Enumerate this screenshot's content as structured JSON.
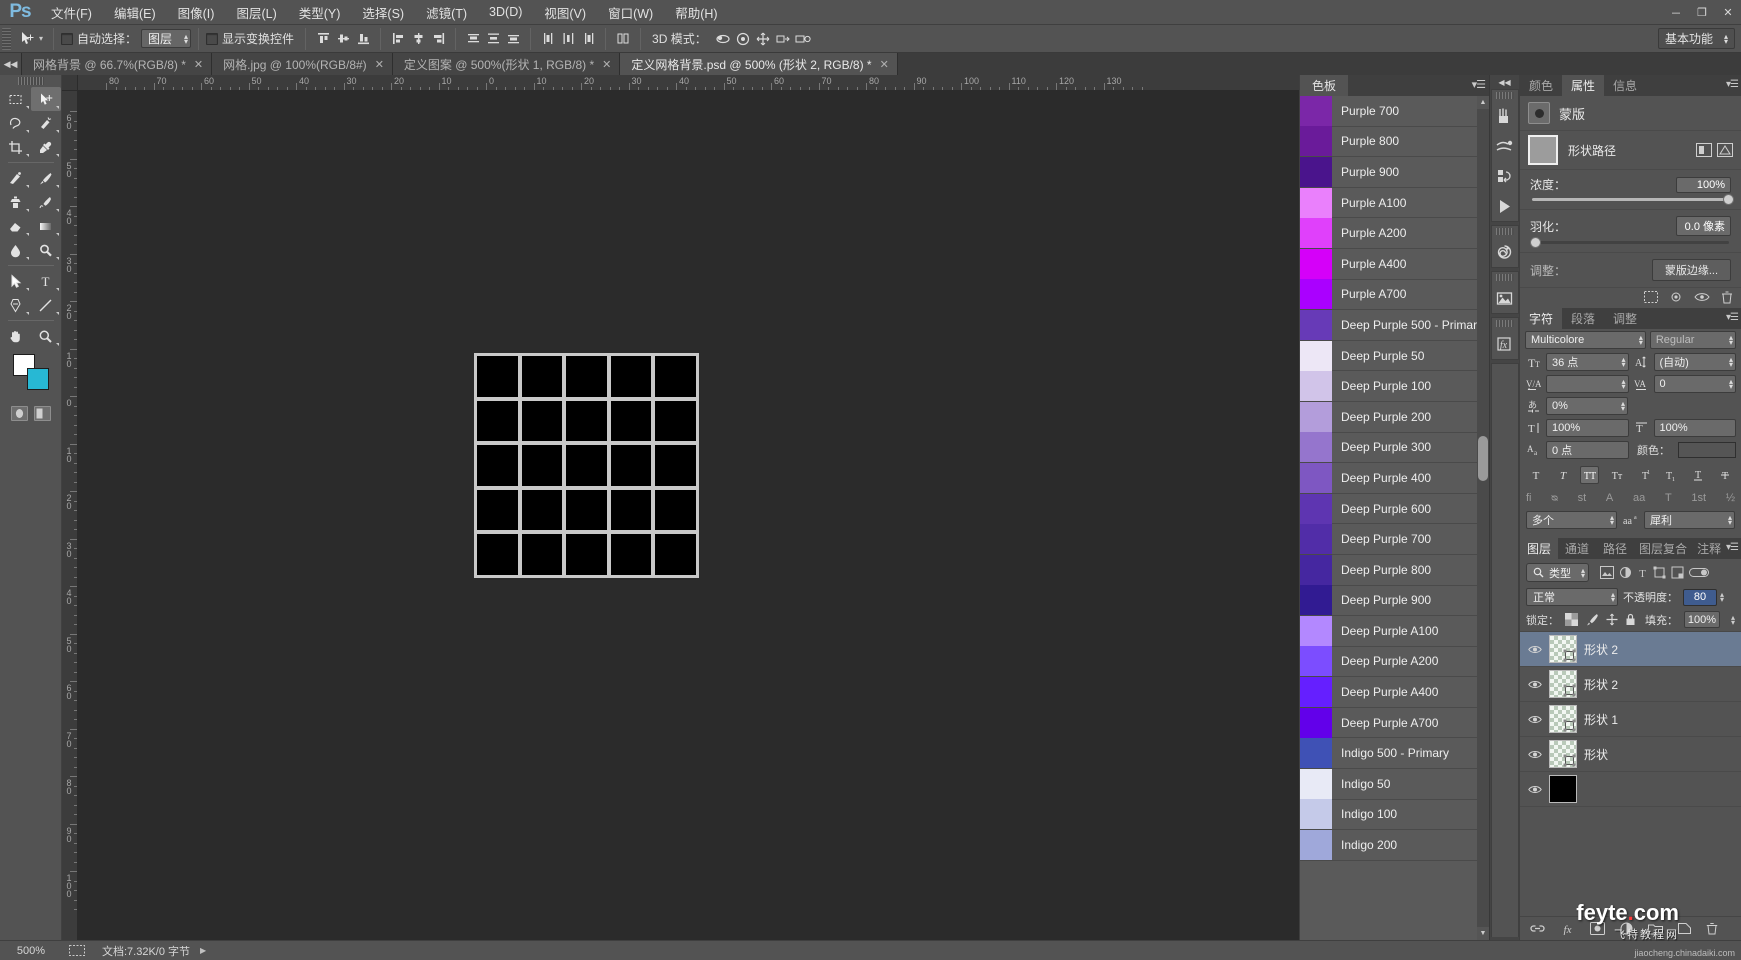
{
  "app": {
    "logo": "Ps",
    "menus": [
      "文件(F)",
      "编辑(E)",
      "图像(I)",
      "图层(L)",
      "类型(Y)",
      "选择(S)",
      "滤镜(T)",
      "3D(D)",
      "视图(V)",
      "窗口(W)",
      "帮助(H)"
    ],
    "window_buttons": [
      "－",
      "❐",
      "✕"
    ]
  },
  "options_bar": {
    "auto_select_label": "自动选择：",
    "auto_select_value": "图层",
    "show_transform_label": "显示变换控件",
    "mode3d_label": "3D 模式：",
    "workspace_label": "基本功能"
  },
  "tabs": [
    {
      "title": "网格背景 @ 66.7%(RGB/8) *",
      "active": false
    },
    {
      "title": "网格.jpg @ 100%(RGB/8#)",
      "active": false
    },
    {
      "title": "定义图案 @ 500%(形状 1, RGB/8) *",
      "active": false
    },
    {
      "title": "定义网格背景.psd @ 500% (形状 2, RGB/8) *",
      "active": true
    }
  ],
  "ruler": {
    "h_labels": [
      "80",
      "70",
      "60",
      "50",
      "40",
      "30",
      "20",
      "10",
      "0",
      "10",
      "20",
      "30",
      "40",
      "50",
      "60",
      "70",
      "80",
      "90",
      "100",
      "110",
      "120",
      "130"
    ],
    "v_labels": [
      "60",
      "50",
      "40",
      "30",
      "20",
      "10",
      "0",
      "10",
      "20",
      "30",
      "40",
      "50",
      "60",
      "70",
      "80",
      "90",
      "100"
    ]
  },
  "swatches_panel": {
    "tab_label": "色板",
    "items": [
      {
        "name": "Purple 700",
        "color": "#7b27a8"
      },
      {
        "name": "Purple 800",
        "color": "#6a1b9a"
      },
      {
        "name": "Purple 900",
        "color": "#4a148c"
      },
      {
        "name": "Purple A100",
        "color": "#ea80fc"
      },
      {
        "name": "Purple A200",
        "color": "#e040fb"
      },
      {
        "name": "Purple A400",
        "color": "#d500f9"
      },
      {
        "name": "Purple A700",
        "color": "#aa00ff"
      },
      {
        "name": "Deep Purple 500 - Primary",
        "color": "#673ab7"
      },
      {
        "name": "Deep Purple 50",
        "color": "#ede7f6"
      },
      {
        "name": "Deep Purple 100",
        "color": "#d1c4e9"
      },
      {
        "name": "Deep Purple 200",
        "color": "#b39ddb"
      },
      {
        "name": "Deep Purple 300",
        "color": "#9575cd"
      },
      {
        "name": "Deep Purple 400",
        "color": "#7e57c2"
      },
      {
        "name": "Deep Purple 600",
        "color": "#5e35b1"
      },
      {
        "name": "Deep Purple 700",
        "color": "#512da8"
      },
      {
        "name": "Deep Purple 800",
        "color": "#4527a0"
      },
      {
        "name": "Deep Purple 900",
        "color": "#311b92"
      },
      {
        "name": "Deep Purple A100",
        "color": "#b388ff"
      },
      {
        "name": "Deep Purple A200",
        "color": "#7c4dff"
      },
      {
        "name": "Deep Purple A400",
        "color": "#651fff"
      },
      {
        "name": "Deep Purple A700",
        "color": "#6200ea"
      },
      {
        "name": "Indigo 500 - Primary",
        "color": "#3f51b5"
      },
      {
        "name": "Indigo 50",
        "color": "#e8eaf6"
      },
      {
        "name": "Indigo 100",
        "color": "#c5cae9"
      },
      {
        "name": "Indigo 200",
        "color": "#9fa8da"
      }
    ]
  },
  "properties_panel": {
    "tabs": [
      "颜色",
      "属性",
      "信息"
    ],
    "active_tab": "属性",
    "mask_title": "蒙版",
    "mask_type_label": "形状路径",
    "density_label": "浓度：",
    "density_value": "100%",
    "feather_label": "羽化：",
    "feather_value": "0.0 像素",
    "adjust_label": "调整：",
    "mask_edge_button": "蒙版边缘..."
  },
  "character_panel": {
    "tabs": [
      "字符",
      "段落",
      "调整"
    ],
    "active_tab": "字符",
    "font_family": "Multicolore",
    "font_style": "Regular",
    "font_size": "36 点",
    "leading": "(自动)",
    "kerning": "",
    "tracking": "0",
    "vertical_scale_label": "0%",
    "scale_h": "100%",
    "scale_v": "100%",
    "baseline_shift": "0 点",
    "color_label": "颜色：",
    "color_value": "#555555",
    "style_buttons": [
      "T",
      "T",
      "TT",
      "Tr",
      "T¹",
      "T₁",
      "T",
      "T"
    ],
    "opentype_buttons": [
      "fi",
      "ᴓ",
      "st",
      "A",
      "aa",
      "T",
      "1st",
      "½"
    ],
    "language": "多个",
    "aa_label": "aa",
    "antialias": "犀利"
  },
  "layers_panel": {
    "tabs": [
      "图层",
      "通道",
      "路径",
      "图层复合",
      "注释"
    ],
    "active_tab": "图层",
    "filter_label": "类型",
    "blend_mode": "正常",
    "opacity_label": "不透明度：",
    "opacity_value": "80",
    "lock_label": "锁定：",
    "fill_label": "填充：",
    "fill_value": "100%",
    "layers": [
      {
        "name": "形状 2",
        "selected": true,
        "type": "transparent"
      },
      {
        "name": "形状 2",
        "selected": false,
        "type": "transparent"
      },
      {
        "name": "形状 1",
        "selected": false,
        "type": "transparent"
      },
      {
        "name": "形状",
        "selected": false,
        "type": "transparent"
      },
      {
        "name": "",
        "selected": false,
        "type": "solid"
      }
    ]
  },
  "status_bar": {
    "zoom": "500%",
    "doc_info": "文档:7.32K/0 字节"
  },
  "watermark": {
    "line1": "feyte",
    "line1b": "com",
    "line2": "飞特教程网",
    "line3": "jiaocheng.chinadaiki.com"
  },
  "canvas": {
    "grid_rows": 5,
    "grid_cols": 5,
    "border_color": "#c9c9c9",
    "cell_color": "#000000",
    "background": "#2b2b2b"
  },
  "swatch_colors": {
    "foreground": "#ffffff",
    "background": "#27b8d4"
  }
}
